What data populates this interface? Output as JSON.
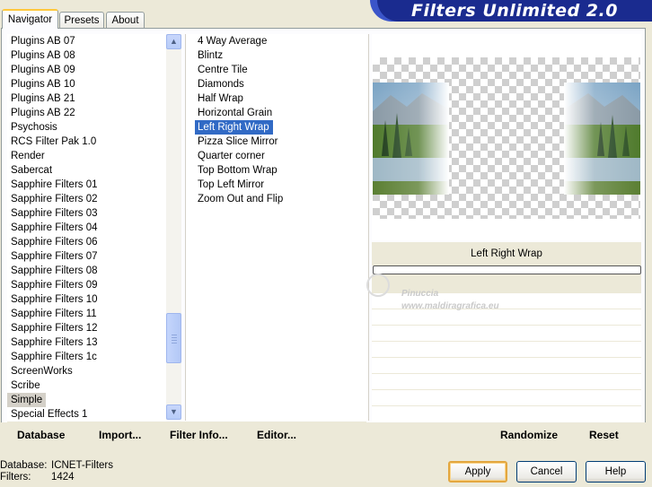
{
  "app": {
    "title": "Filters Unlimited 2.0"
  },
  "tabs": [
    {
      "label": "Navigator",
      "active": true
    },
    {
      "label": "Presets",
      "active": false
    },
    {
      "label": "About",
      "active": false
    }
  ],
  "categories": [
    "Plugins AB 07",
    "Plugins AB 08",
    "Plugins AB 09",
    "Plugins AB 10",
    "Plugins AB 21",
    "Plugins AB 22",
    "Psychosis",
    "RCS Filter Pak 1.0",
    "Render",
    "Sabercat",
    "Sapphire Filters 01",
    "Sapphire Filters 02",
    "Sapphire Filters 03",
    "Sapphire Filters 04",
    "Sapphire Filters 06",
    "Sapphire Filters 07",
    "Sapphire Filters 08",
    "Sapphire Filters 09",
    "Sapphire Filters 10",
    "Sapphire Filters 11",
    "Sapphire Filters 12",
    "Sapphire Filters 13",
    "Sapphire Filters 1c",
    "ScreenWorks",
    "Scribe",
    "Simple",
    "Special Effects 1"
  ],
  "selected_category": "Simple",
  "filters": [
    "4 Way Average",
    "Blintz",
    "Centre Tile",
    "Diamonds",
    "Half Wrap",
    "Horizontal Grain",
    "Left Right Wrap",
    "Pizza Slice Mirror",
    "Quarter corner",
    "Top Bottom Wrap",
    "Top Left Mirror",
    "Zoom Out and Flip"
  ],
  "selected_filter": "Left Right Wrap",
  "preview": {
    "filter_name": "Left Right Wrap"
  },
  "watermark": {
    "line1": "Pinuccia",
    "line2": "www.maldiragrafica.eu"
  },
  "bottom_links": {
    "database": "Database",
    "import": "Import...",
    "filter_info": "Filter Info...",
    "editor": "Editor...",
    "randomize": "Randomize",
    "reset": "Reset"
  },
  "status": {
    "database_label": "Database:",
    "database_value": "ICNET-Filters",
    "filters_label": "Filters:",
    "filters_value": "1424"
  },
  "buttons": {
    "apply": "Apply",
    "cancel": "Cancel",
    "help": "Help"
  },
  "icons": {
    "scroll_up": "▲",
    "scroll_down": "▼"
  }
}
